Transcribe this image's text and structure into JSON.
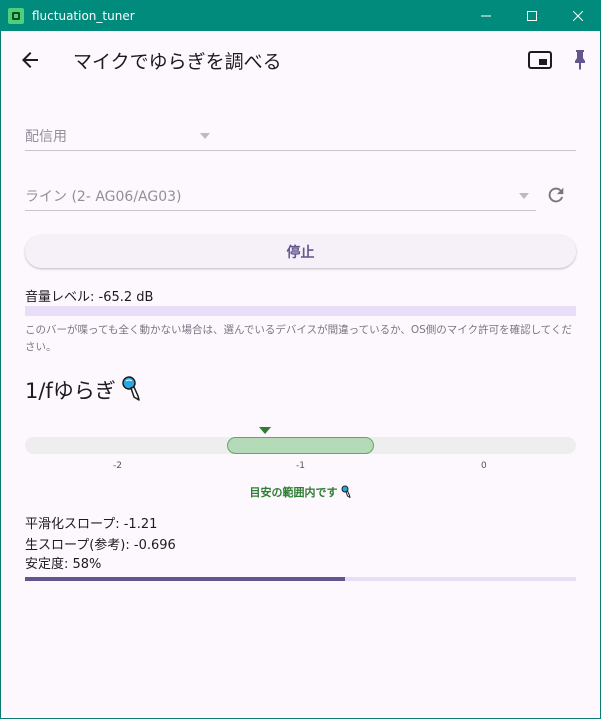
{
  "window": {
    "title": "fluctuation_tuner"
  },
  "appbar": {
    "title": "マイクでゆらぎを調べる",
    "back_icon": "arrow-left-icon",
    "pip_icon": "picture-in-picture-icon",
    "pin_icon": "push-pin-icon",
    "accent": "#65558f"
  },
  "form": {
    "preset": {
      "value": "配信用"
    },
    "device": {
      "value": "ライン (2- AG06/AG03)"
    }
  },
  "stop_button": {
    "label": "停止"
  },
  "level": {
    "label": "音量レベル: -65.2 dB",
    "fill_fraction": 0.0,
    "hint": "このバーが喋っても全く動かない場合は、選んでいるデバイスが間違っているか、OS側のマイク許可を確認してください。"
  },
  "fluctuation": {
    "title": "1/fゆらぎ",
    "ticks": [
      "-2",
      "-1",
      "0"
    ],
    "status": "目安の範囲内です",
    "status_color": "#2e7d32",
    "smoothed_slope": "平滑化スロープ: -1.21",
    "raw_slope": "生スロープ(参考): -0.696",
    "stability": "安定度: 58%",
    "stability_fraction": 0.58
  }
}
